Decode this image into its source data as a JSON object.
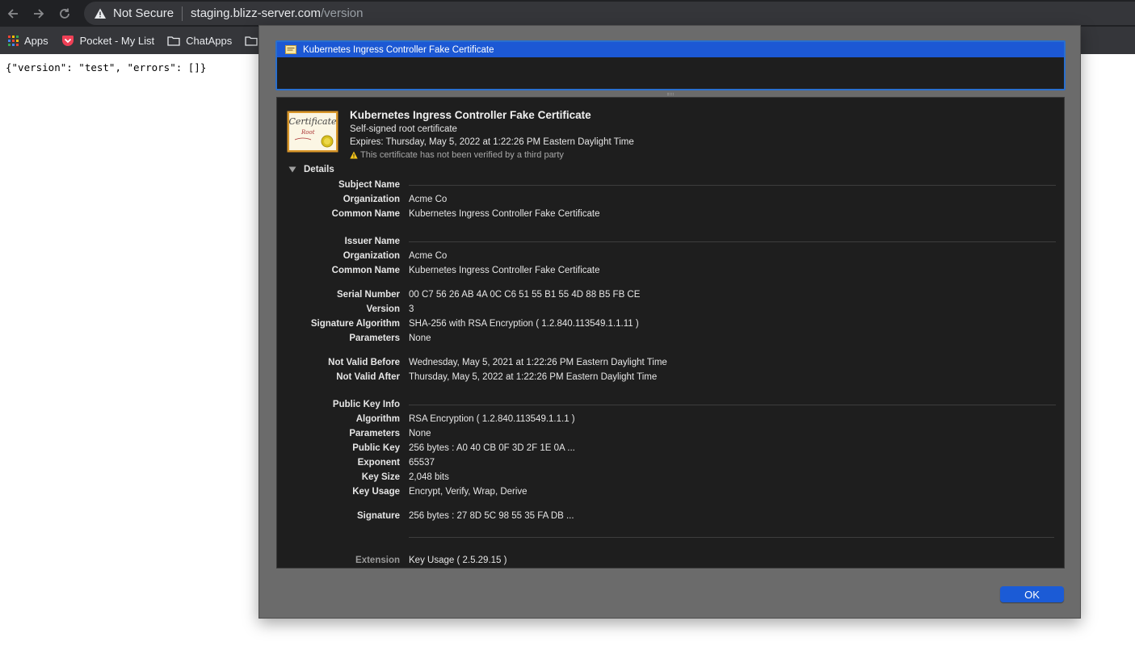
{
  "browser": {
    "security_label": "Not Secure",
    "url_host": "staging.blizz-server.com",
    "url_path": "/version",
    "bookmarks": [
      "Apps",
      "Pocket - My List",
      "ChatApps"
    ]
  },
  "page": {
    "json_text": "{\"version\": \"test\", \"errors\": []}"
  },
  "certificate": {
    "list_item": "Kubernetes Ingress Controller Fake Certificate",
    "title": "Kubernetes Ingress Controller Fake Certificate",
    "subtitle": "Self-signed root certificate",
    "expires": "Expires: Thursday, May 5, 2022 at 1:22:26 PM Eastern Daylight Time",
    "warning": "This certificate has not been verified by a third party",
    "details_label": "Details",
    "subject_name": {
      "header": "Subject Name",
      "organization_label": "Organization",
      "organization": "Acme Co",
      "common_name_label": "Common Name",
      "common_name": "Kubernetes Ingress Controller Fake Certificate"
    },
    "issuer_name": {
      "header": "Issuer Name",
      "organization_label": "Organization",
      "organization": "Acme Co",
      "common_name_label": "Common Name",
      "common_name": "Kubernetes Ingress Controller Fake Certificate"
    },
    "serial_number_label": "Serial Number",
    "serial_number": "00 C7 56 26 AB 4A 0C C6 51 55 B1 55 4D 88 B5 FB CE",
    "version_label": "Version",
    "version": "3",
    "signature_algorithm_label": "Signature Algorithm",
    "signature_algorithm": "SHA-256 with RSA Encryption ( 1.2.840.113549.1.1.11 )",
    "parameters_label": "Parameters",
    "parameters": "None",
    "not_valid_before_label": "Not Valid Before",
    "not_valid_before": "Wednesday, May 5, 2021 at 1:22:26 PM Eastern Daylight Time",
    "not_valid_after_label": "Not Valid After",
    "not_valid_after": "Thursday, May 5, 2022 at 1:22:26 PM Eastern Daylight Time",
    "public_key": {
      "header": "Public Key Info",
      "algorithm_label": "Algorithm",
      "algorithm": "RSA Encryption ( 1.2.840.113549.1.1.1 )",
      "parameters_label": "Parameters",
      "parameters": "None",
      "public_key_label": "Public Key",
      "public_key": "256 bytes : A0 40 CB 0F 3D 2F 1E 0A ...",
      "exponent_label": "Exponent",
      "exponent": "65537",
      "key_size_label": "Key Size",
      "key_size": "2,048 bits",
      "key_usage_label": "Key Usage",
      "key_usage": "Encrypt, Verify, Wrap, Derive"
    },
    "signature_label": "Signature",
    "signature": "256 bytes : 27 8D 5C 98 55 35 FA DB ...",
    "extension_label": "Extension",
    "extension": "Key Usage ( 2.5.29.15 )"
  },
  "dialog": {
    "ok_label": "OK",
    "accent": "#1b5bd6"
  }
}
